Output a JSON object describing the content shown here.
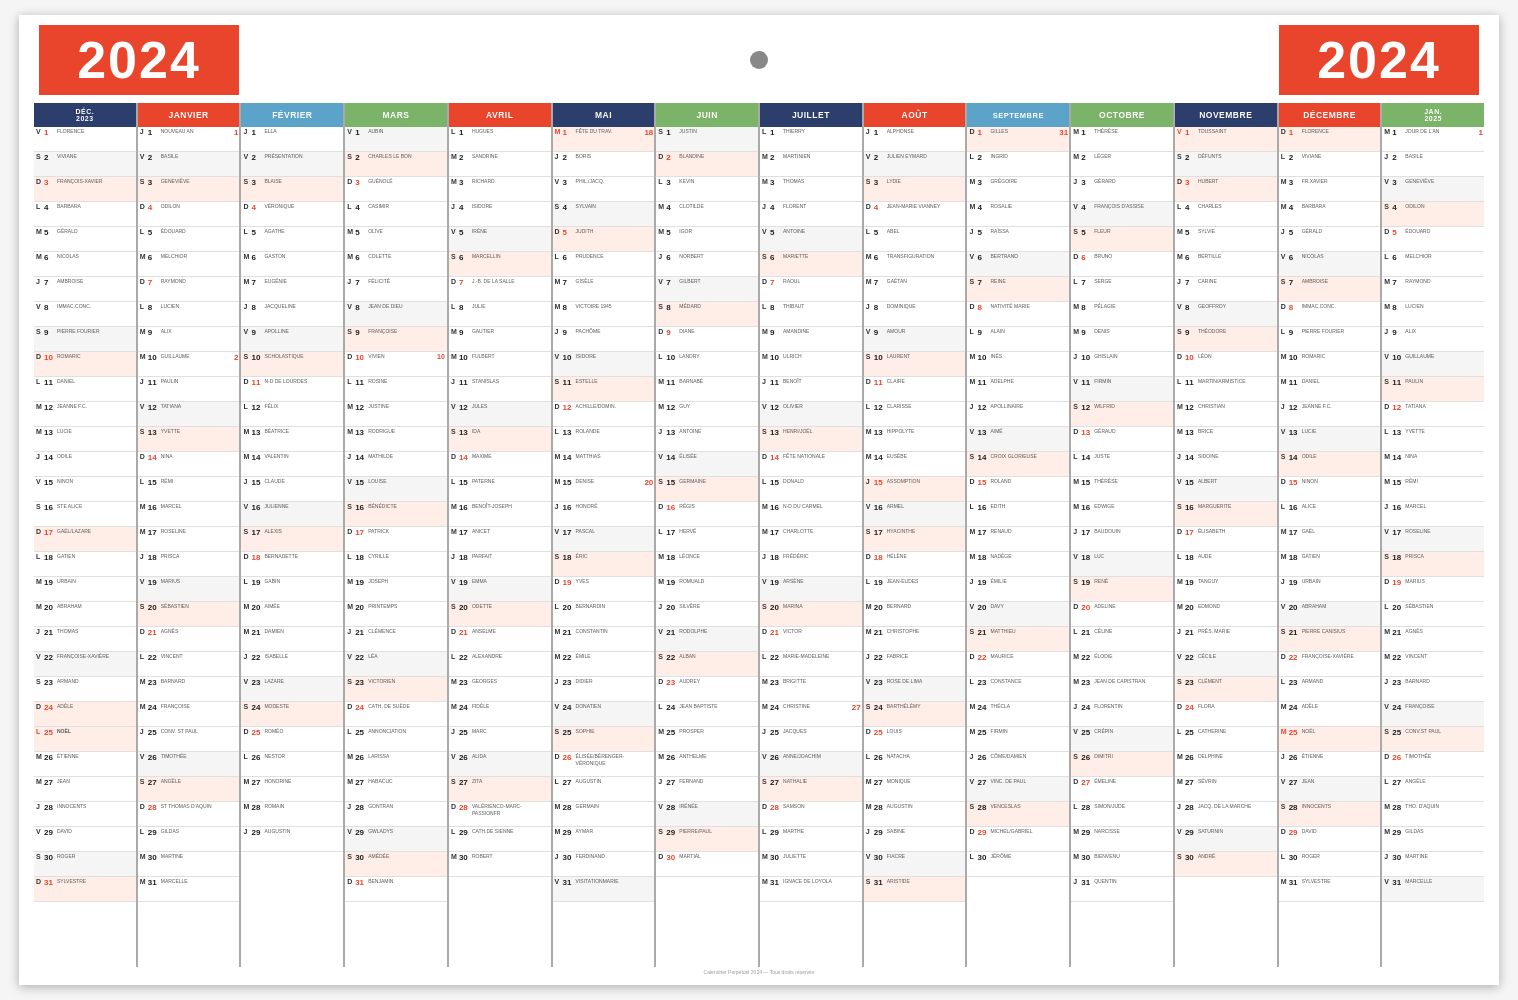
{
  "header": {
    "year": "2024",
    "year2": "2024",
    "hole": true
  },
  "months": [
    {
      "id": "dec2023",
      "label": "DÉC. 2023",
      "color": "#2c3e6b",
      "short": "DÉC.\n2023"
    },
    {
      "id": "jan",
      "label": "JANVIER",
      "color": "#e8452c"
    },
    {
      "id": "feb",
      "label": "FÉVRIER",
      "color": "#5ba3c9"
    },
    {
      "id": "mar",
      "label": "MARS",
      "color": "#7bb369"
    },
    {
      "id": "apr",
      "label": "AVRIL",
      "color": "#e8452c"
    },
    {
      "id": "may",
      "label": "MAI",
      "color": "#2c3e6b"
    },
    {
      "id": "jun",
      "label": "JUIN",
      "color": "#7bb369"
    },
    {
      "id": "jul",
      "label": "JUILLET",
      "color": "#2c3e6b"
    },
    {
      "id": "aug",
      "label": "AOÛT",
      "color": "#e8452c"
    },
    {
      "id": "sep",
      "label": "SEPTEMBRE",
      "color": "#5ba3c9"
    },
    {
      "id": "oct",
      "label": "OCTOBRE",
      "color": "#7bb369"
    },
    {
      "id": "nov",
      "label": "NOVEMBRE",
      "color": "#2c3e6b"
    },
    {
      "id": "dec",
      "label": "DÉCEMBRE",
      "color": "#e8452c"
    },
    {
      "id": "jan2025",
      "label": "JAN. 2025",
      "color": "#7bb369"
    }
  ]
}
